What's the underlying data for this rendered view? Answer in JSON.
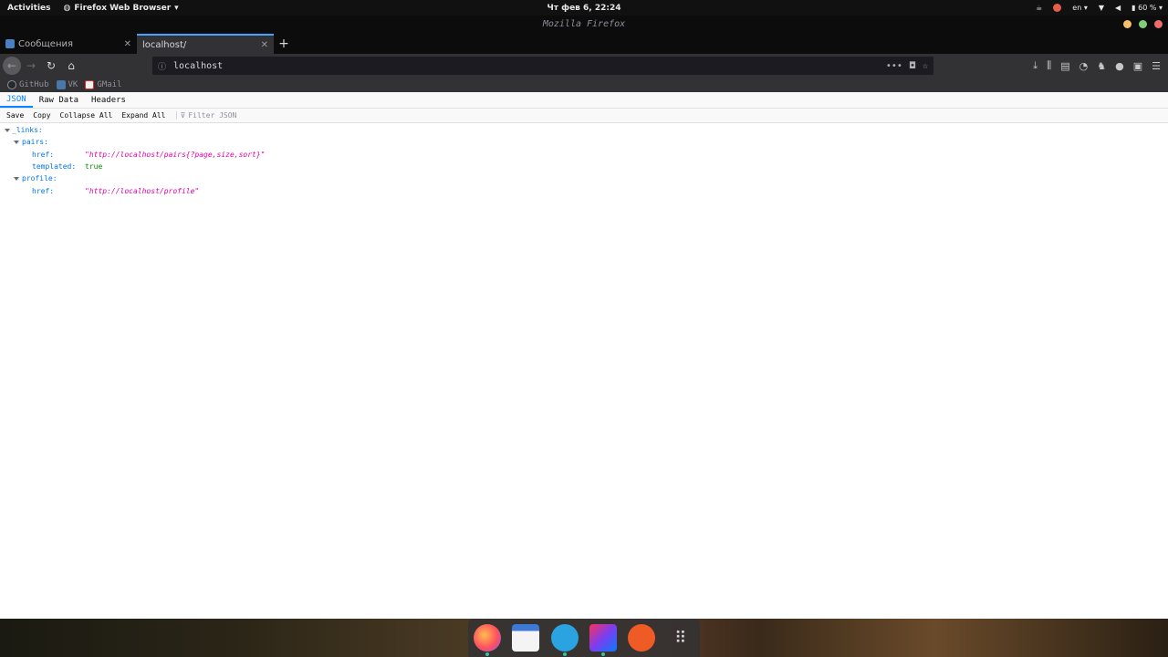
{
  "topbar": {
    "activities": "Activities",
    "app_name": "Firefox Web Browser",
    "clock": "Чт фев 6, 22:24",
    "lang": "en",
    "battery": "60 %"
  },
  "window": {
    "title": "Mozilla Firefox",
    "buttons_colors": [
      "#f4c06a",
      "#7fcf7a",
      "#f06c6c"
    ]
  },
  "tabs": [
    {
      "title": "Сообщения",
      "close": "✕",
      "active": false
    },
    {
      "title": "localhost/",
      "close": "✕",
      "active": true
    }
  ],
  "newtab": "+",
  "navbar": {
    "back": "←",
    "forward": "→",
    "reload": "↻",
    "home": "⌂",
    "url": "localhost",
    "info": "ⓘ",
    "more": "•••",
    "star": "☆"
  },
  "bookmarks": [
    {
      "label": "GitHub",
      "color": "#24292e"
    },
    {
      "label": "VK",
      "color": "#4a76a8"
    },
    {
      "label": "GMail",
      "color": "#d93025"
    }
  ],
  "viewer": {
    "tabs": [
      "JSON",
      "Raw Data",
      "Headers"
    ],
    "toolbar": [
      "Save",
      "Copy",
      "Collapse All",
      "Expand All"
    ],
    "filter_placeholder": "Filter JSON"
  },
  "json_tree": {
    "links_key": "_links:",
    "pairs_key": "pairs:",
    "pairs_href_key": "href:",
    "pairs_href_val": "\"http://localhost/pairs{?page,size,sort}\"",
    "templated_key": "templated:",
    "templated_val": "true",
    "profile_key": "profile:",
    "profile_href_key": "href:",
    "profile_href_val": "\"http://localhost/profile\""
  },
  "dock": {
    "apps": [
      "firefox",
      "files",
      "telegram",
      "intellij",
      "postman",
      "app-grid"
    ]
  },
  "colors": {
    "accent": "#0a84ff",
    "json_key": "#0074e8",
    "json_string": "#dd00a9",
    "json_bool": "#058b00"
  }
}
